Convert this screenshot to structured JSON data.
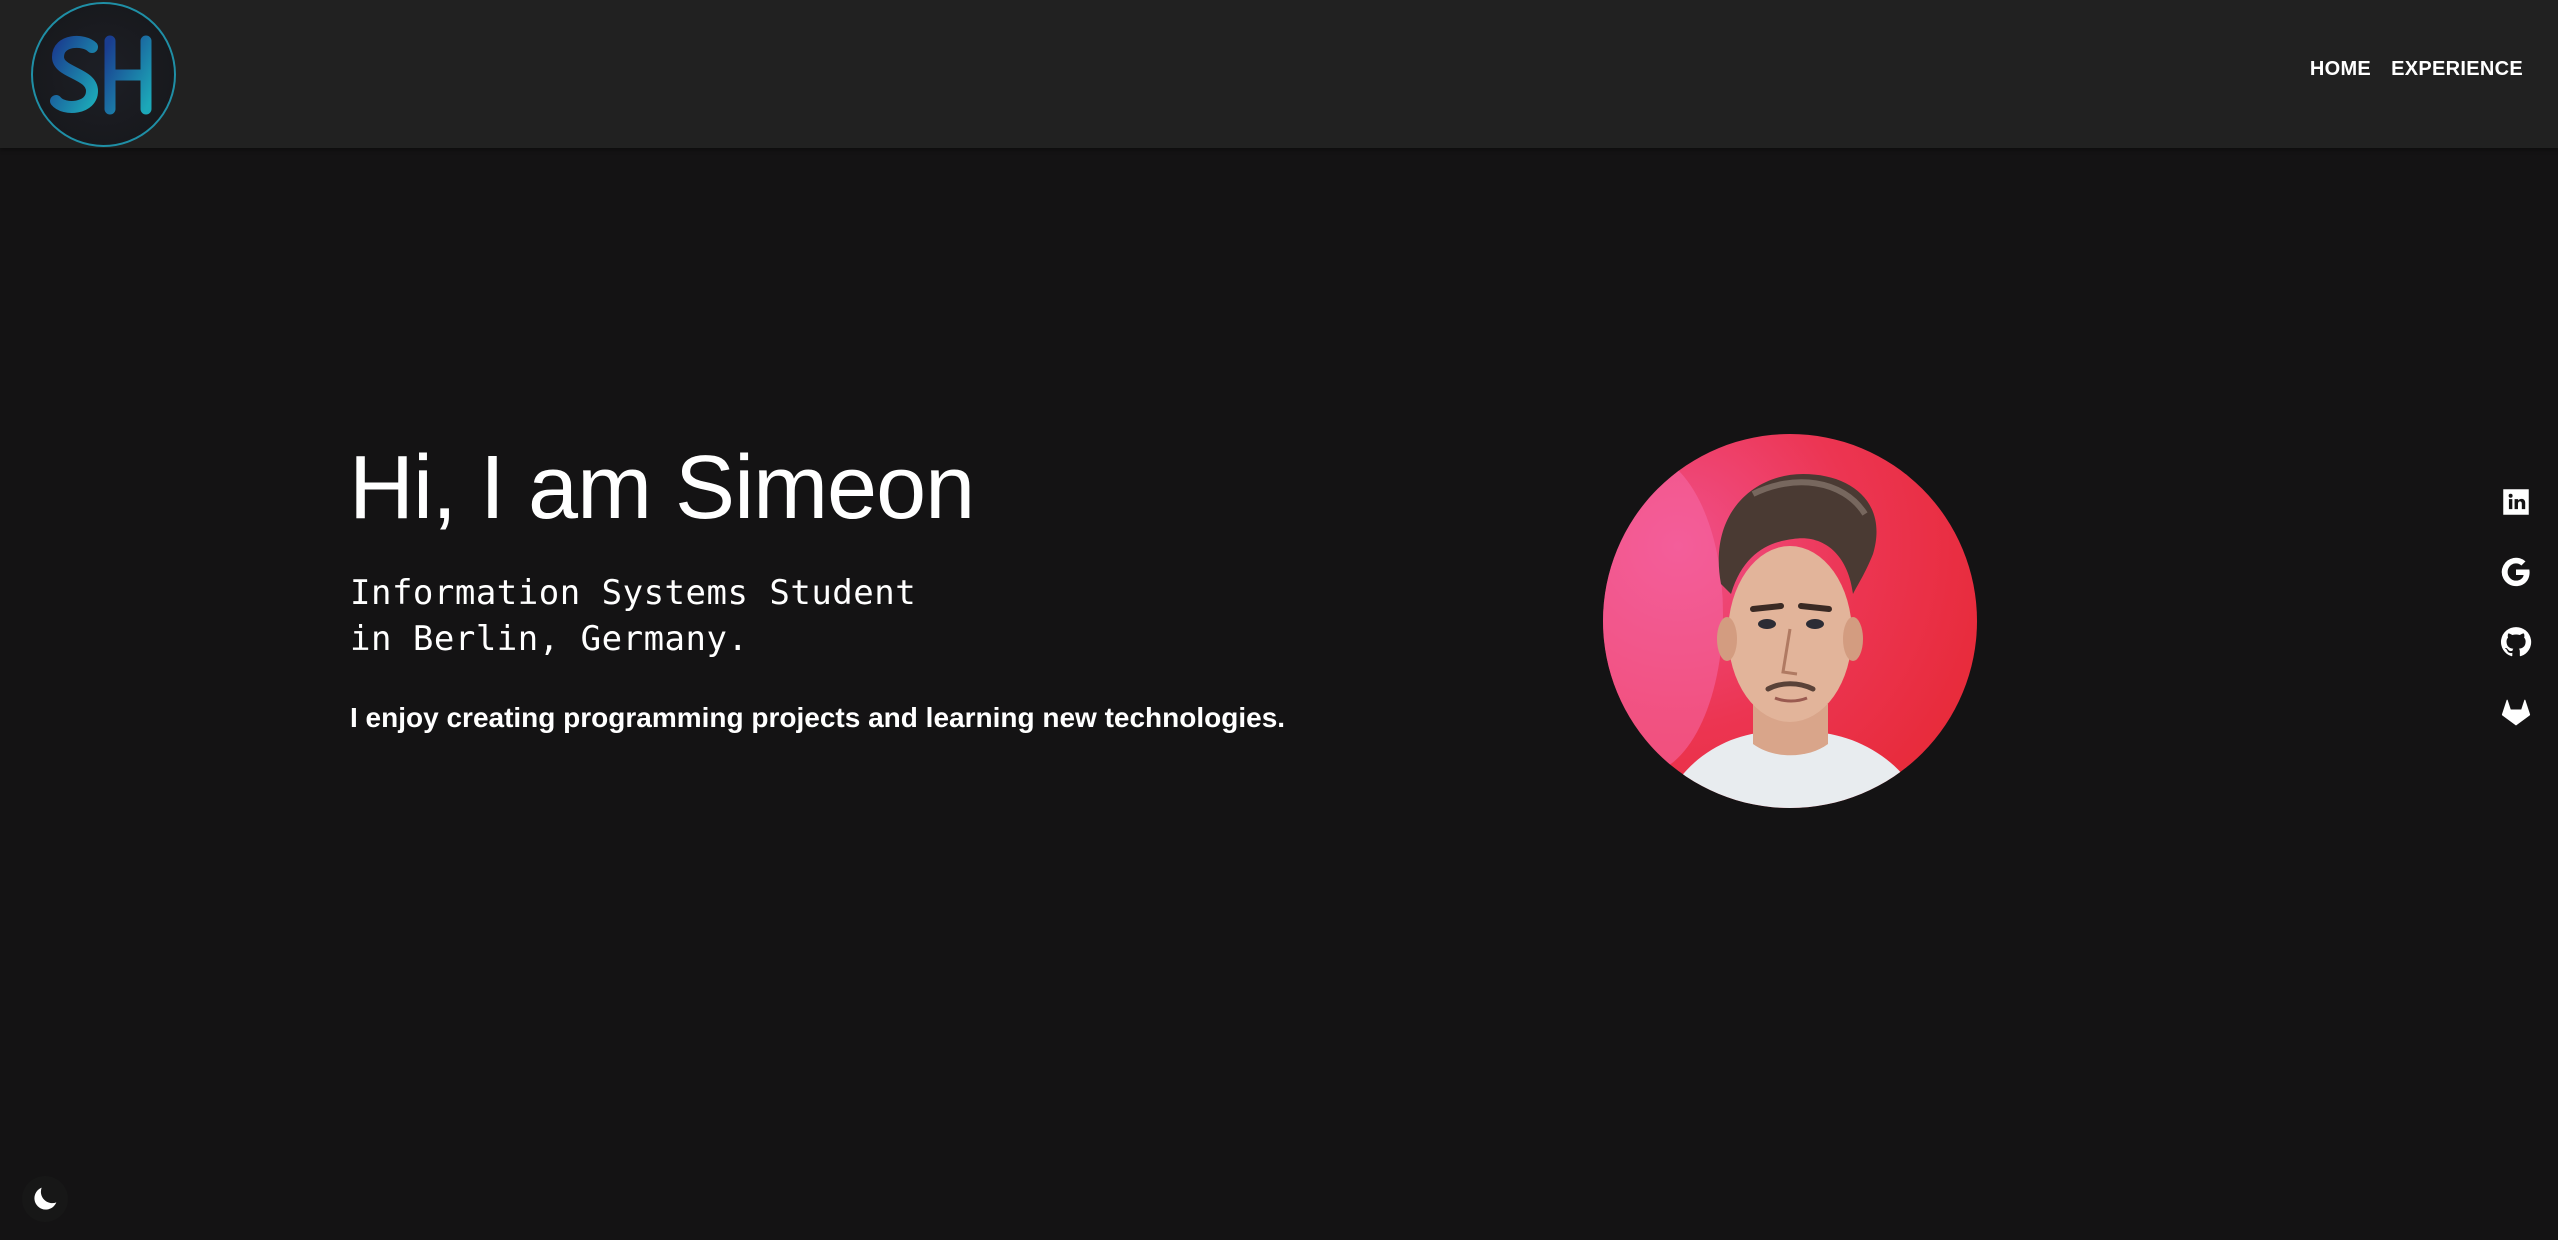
{
  "header": {
    "logo_text": "SH",
    "logo_icon": "sh-monogram-logo",
    "nav": [
      {
        "label": "HOME"
      },
      {
        "label": "EXPERIENCE"
      }
    ]
  },
  "hero": {
    "title": "Hi, I am Simeon",
    "subtitle_line1": "Information Systems Student",
    "subtitle_line2": "in Berlin, Germany.",
    "description": "I enjoy creating programming projects and learning new technologies."
  },
  "portrait": {
    "icon": "profile-photo"
  },
  "social": [
    {
      "icon": "linkedin-icon"
    },
    {
      "icon": "google-icon"
    },
    {
      "icon": "github-icon"
    },
    {
      "icon": "gitlab-icon"
    }
  ],
  "theme_toggle": {
    "icon": "moon-icon"
  },
  "colors": {
    "background": "#141314",
    "header": "#212121",
    "text": "#ffffff",
    "logo_accent": "#1f8fa6",
    "portrait_bg": "#ec3552"
  }
}
